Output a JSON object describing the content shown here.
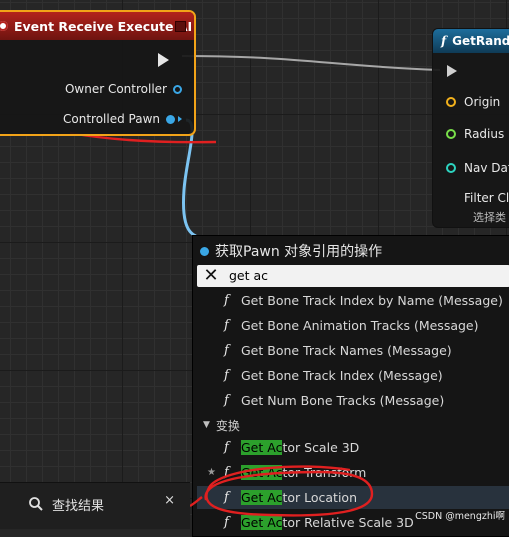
{
  "event_node": {
    "title": "Event Receive Execute AI",
    "pins": [
      "Owner Controller",
      "Controlled Pawn"
    ]
  },
  "rand_node": {
    "title": "GetRand",
    "pins": [
      "Origin",
      "Radius",
      "Nav Dat",
      "Filter Cla"
    ],
    "sub_text": "选择类",
    "pin_colors": [
      "#f2b11c",
      "#79e04a",
      "#2dd4c0",
      "#6a3fb3"
    ]
  },
  "menu": {
    "title": "获取Pawn 对象引用的操作",
    "search_value": "get ac",
    "items": [
      {
        "prefix": "",
        "highlight": "",
        "text": "Get Bone Track Index by Name (Message)"
      },
      {
        "prefix": "",
        "highlight": "",
        "text": "Get Bone Animation Tracks (Message)"
      },
      {
        "prefix": "",
        "highlight": "",
        "text": "Get Bone Track Names (Message)"
      },
      {
        "prefix": "",
        "highlight": "",
        "text": "Get Bone Track Index (Message)"
      },
      {
        "prefix": "",
        "highlight": "",
        "text": "Get Num Bone Tracks (Message)"
      }
    ],
    "category": "变换",
    "transform_items": [
      {
        "highlight": "Get Ac",
        "text": "tor Scale 3D"
      },
      {
        "highlight": "Get Ac",
        "text": "tor Transform"
      },
      {
        "highlight": "Get Ac",
        "text": "tor Location"
      },
      {
        "highlight": "Get Ac",
        "text": "tor Relative Scale 3D"
      }
    ]
  },
  "find_tab": {
    "label": "查找结果",
    "close": "×"
  },
  "watermark": "CSDN @mengzhi啊",
  "colors": {
    "accent_pin": "#3aa7e6",
    "event_border": "#f2a318",
    "highlight": "#2ca02c",
    "annotation": "#e02020"
  }
}
